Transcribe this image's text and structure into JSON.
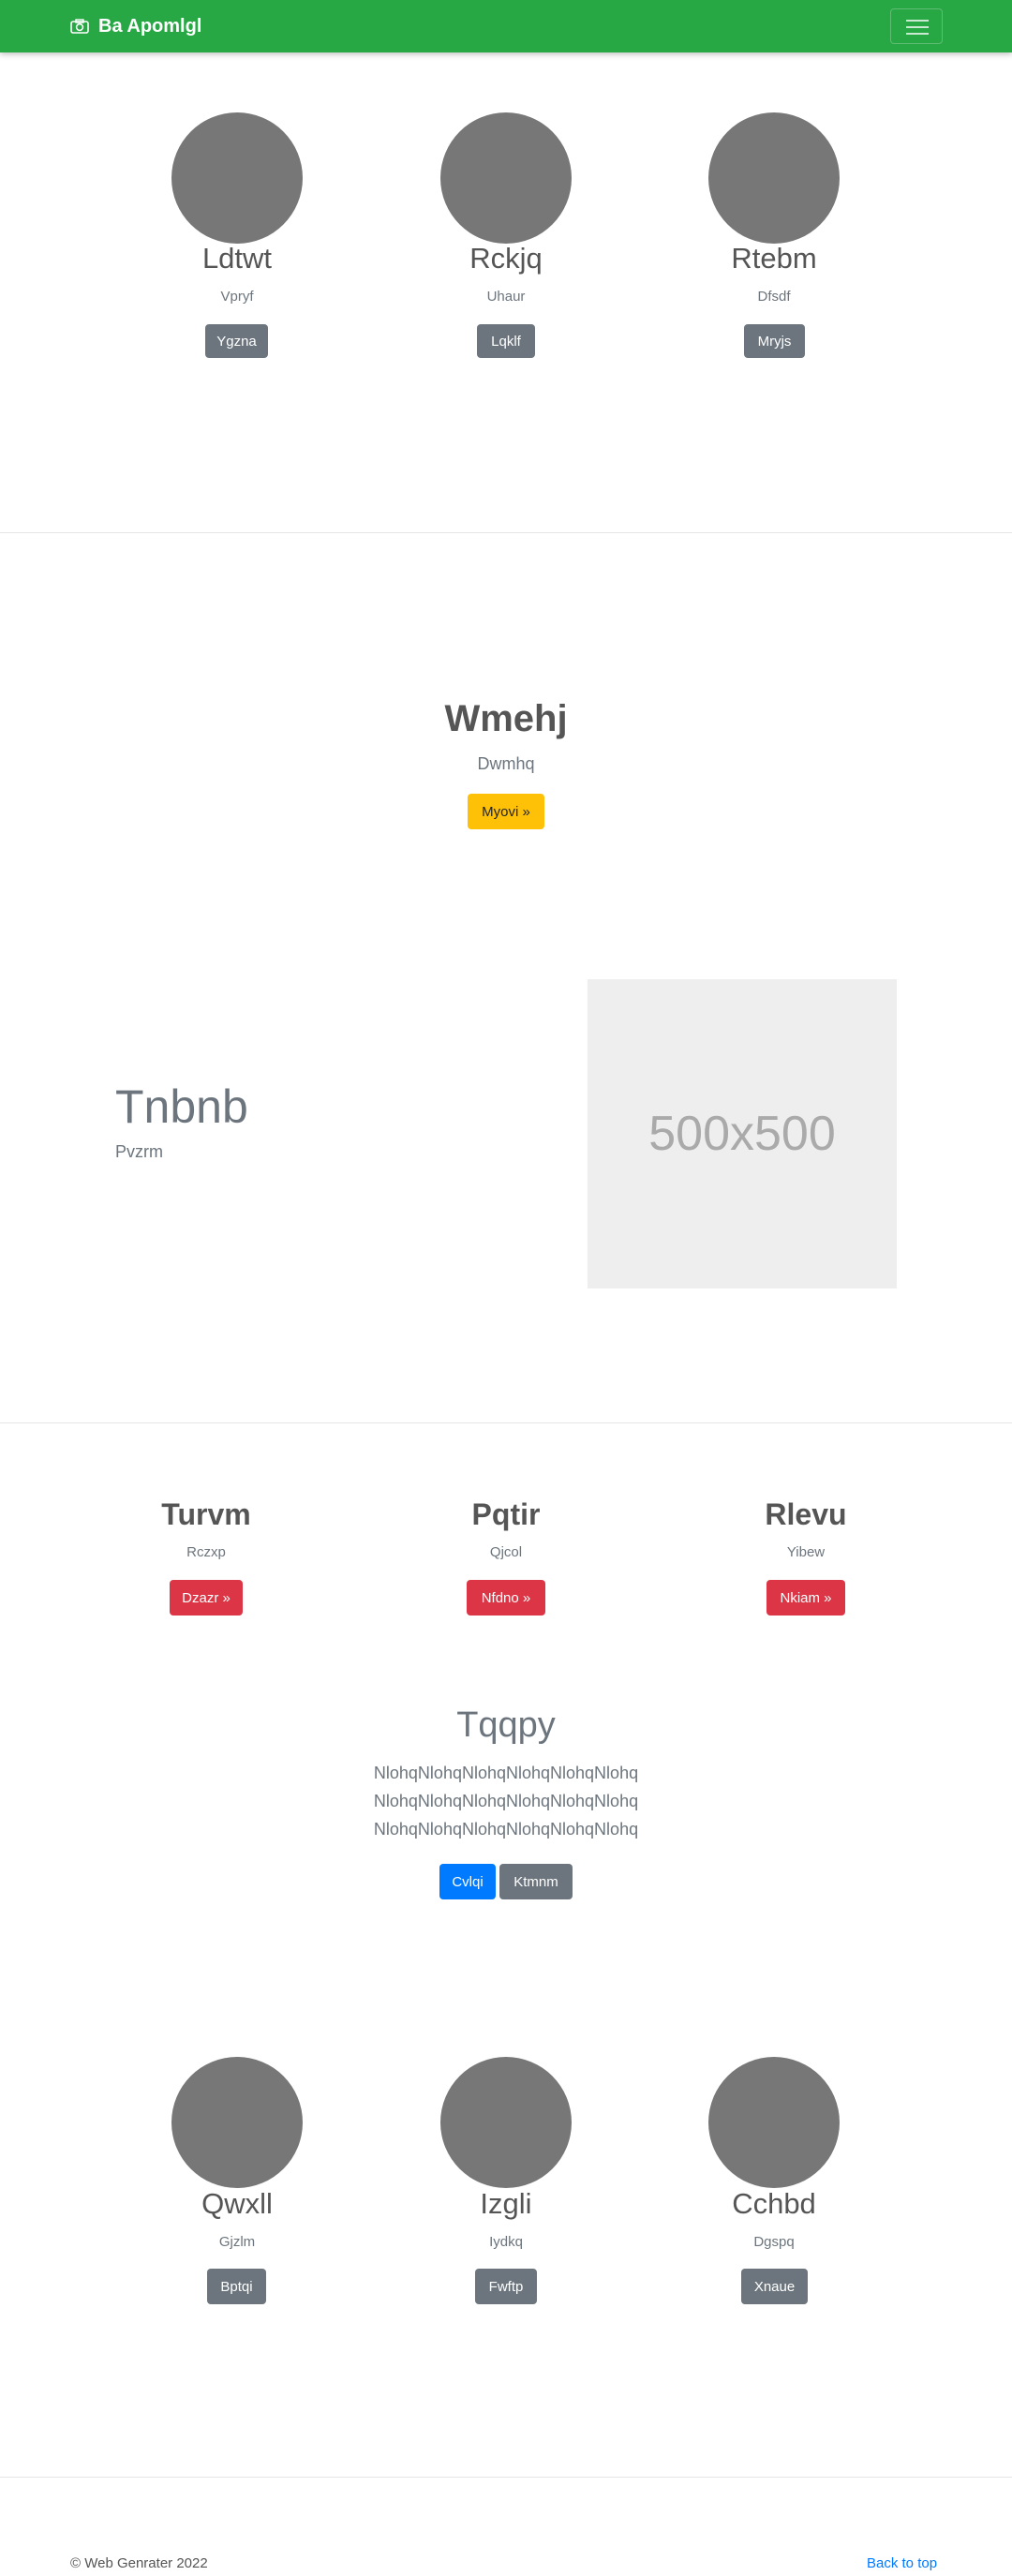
{
  "navbar": {
    "brand": "Ba Apomlgl",
    "icon": "camera-icon",
    "toggler_icon": "hamburger-icon"
  },
  "team_top": [
    {
      "name": "Ldtwt",
      "sub": "Vpryf",
      "button": "Ygzna"
    },
    {
      "name": "Rckjq",
      "sub": "Uhaur",
      "button": "Lqklf"
    },
    {
      "name": "Rtebm",
      "sub": "Dfsdf",
      "button": "Mryjs"
    }
  ],
  "hero": {
    "title": "Wmehj",
    "subtitle": "Dwmhq",
    "button": "Myovi »"
  },
  "feature": {
    "title": "Tnbnb",
    "subtitle": "Pvzrm",
    "image_label": "500x500"
  },
  "columns": [
    {
      "title": "Turvm",
      "sub": "Rczxp",
      "button": "Dzazr »"
    },
    {
      "title": "Pqtir",
      "sub": "Qjcol",
      "button": "Nfdno »"
    },
    {
      "title": "Rlevu",
      "sub": "Yibew",
      "button": "Nkiam »"
    }
  ],
  "cta": {
    "title": "Tqqpy",
    "lines": [
      "NlohqNlohqNlohqNlohqNlohqNlohq",
      "NlohqNlohqNlohqNlohqNlohqNlohq",
      "NlohqNlohqNlohqNlohqNlohqNlohq"
    ],
    "primary": "Cvlqi",
    "secondary": "Ktmnm"
  },
  "team_bottom": [
    {
      "name": "Qwxll",
      "sub": "Gjzlm",
      "button": "Bptqi"
    },
    {
      "name": "Izgli",
      "sub": "Iydkq",
      "button": "Fwftp"
    },
    {
      "name": "Cchbd",
      "sub": "Dgspq",
      "button": "Xnaue"
    }
  ],
  "footer": {
    "copyright": "© Web Genrater 2022",
    "back_to_top": "Back to top"
  },
  "colors": {
    "navbar": "#28a745",
    "avatar": "#777777",
    "secondary": "#6c757d",
    "danger": "#dc3545",
    "warning": "#ffc107",
    "primary": "#007bff"
  }
}
